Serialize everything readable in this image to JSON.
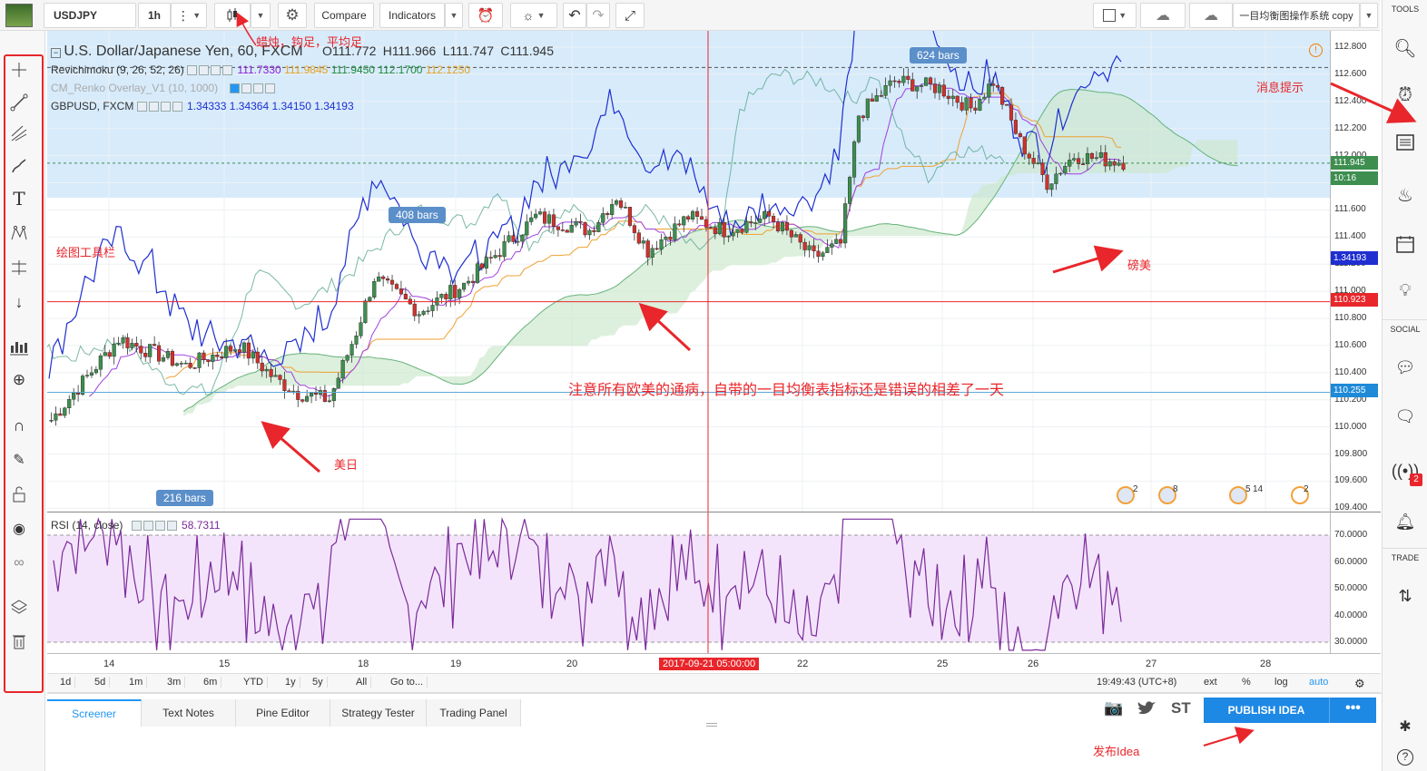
{
  "toolbar": {
    "symbol": "USDJPY",
    "interval": "1h",
    "compare_label": "Compare",
    "indicators_label": "Indicators",
    "layout_name": "一目均衡图操作系统 copy"
  },
  "right_sidebar": {
    "tools_label": "TOOLS",
    "social_label": "SOCIAL",
    "trade_label": "TRADE",
    "notif_badge": "2"
  },
  "legend": {
    "title": "U.S. Dollar/Japanese Yen, 60, FXCM",
    "o": "O111.772",
    "h": "H111.966",
    "l": "L111.747",
    "c": "C111.945",
    "ichimoku_name": "Revichimoku (9, 26, 52, 26)",
    "ichimoku_vals": [
      "111.7330",
      "111.9845",
      "111.9450",
      "112.1700",
      "112.1250"
    ],
    "renko_name": "CM_Renko Overlay_V1 (10, 1000)",
    "gbp_name": "GBPUSD, FXCM",
    "gbp_vals": [
      "1.34333",
      "1.34364",
      "1.34150",
      "1.34193"
    ],
    "rsi_name": "RSI (14, close)",
    "rsi_val": "58.7311"
  },
  "price_axis": {
    "labels": [
      "112.800",
      "112.600",
      "112.400",
      "112.200",
      "112.000",
      "111.800",
      "111.600",
      "111.400",
      "111.200",
      "111.000",
      "110.800",
      "110.600",
      "110.400",
      "110.200",
      "110.000",
      "109.800",
      "109.600",
      "109.400"
    ],
    "tag_current": "111.945",
    "tag_countdown": "10:16",
    "tag_gbp": "1.34193",
    "tag_red": "110.923",
    "tag_blue": "110.255"
  },
  "rsi_axis": {
    "labels": [
      "70.0000",
      "60.0000",
      "50.0000",
      "40.0000",
      "30.0000"
    ]
  },
  "time_axis": {
    "labels": [
      "14",
      "15",
      "18",
      "19",
      "20",
      "22",
      "25",
      "26",
      "27",
      "28"
    ],
    "cursor_label": "2017-09-21 05:00:00"
  },
  "bar_badges": [
    "624 bars",
    "408 bars",
    "216 bars"
  ],
  "events": [
    "2",
    "8",
    "5",
    "14",
    "2"
  ],
  "ranges": [
    "1d",
    "5d",
    "1m",
    "3m",
    "6m",
    "YTD",
    "1y",
    "5y",
    "All",
    "Go to..."
  ],
  "range_right": {
    "time": "19:49:43 (UTC+8)",
    "ext": "ext",
    "pct": "%",
    "log": "log",
    "auto": "auto"
  },
  "bottom": {
    "tabs": [
      "Screener",
      "Text Notes",
      "Pine Editor",
      "Strategy Tester",
      "Trading Panel"
    ],
    "publish": "PUBLISH IDEA",
    "st": "ST"
  },
  "annotations": {
    "chart_type": "蜡烛，钩足，平均足",
    "drawing_tools": "绘图工具栏",
    "news": "消息提示",
    "gbpusd": "磅美",
    "usdjpy": "美日",
    "note": "注意所有欧美的通病，自带的一目均衡表指标还是错误的相差了一天",
    "publish": "发布Idea"
  },
  "colors": {
    "accent": "#2196f3",
    "red_line": "#e8262b",
    "blue_series": "#1f2fd0",
    "rsi": "#7b2a9a",
    "cloud_green": "#cfe8cf",
    "highlight": "#d7ebfb",
    "publish_bg": "#1e88e5"
  }
}
